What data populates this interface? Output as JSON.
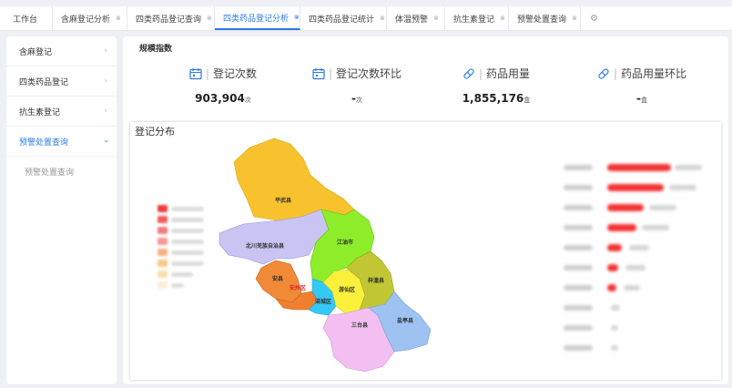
{
  "tabs": [
    {
      "label": "工作台",
      "closable": false,
      "active": false
    },
    {
      "label": "含麻登记分析",
      "closable": true,
      "active": false
    },
    {
      "label": "四类药品登记查询",
      "closable": true,
      "active": false
    },
    {
      "label": "四类药品登记分析",
      "closable": true,
      "active": true
    },
    {
      "label": "四类药品登记统计",
      "closable": true,
      "active": false
    },
    {
      "label": "体温预警",
      "closable": true,
      "active": false
    },
    {
      "label": "抗生素登记",
      "closable": true,
      "active": false
    },
    {
      "label": "预警处置查询",
      "closable": true,
      "active": false
    }
  ],
  "sidebar": {
    "items": [
      {
        "label": "含麻登记",
        "expanded": false
      },
      {
        "label": "四类药品登记",
        "expanded": false
      },
      {
        "label": "抗生素登记",
        "expanded": false
      },
      {
        "label": "预警处置查询",
        "expanded": true
      }
    ],
    "sub_items": [
      "预警处置查询"
    ]
  },
  "section_title": "规模指数",
  "metrics": [
    {
      "label": "登记次数",
      "value": "903,904",
      "unit": "次",
      "icon": "calendar-icon"
    },
    {
      "label": "登记次数环比",
      "value": "-",
      "unit": "次",
      "icon": "calendar-icon"
    },
    {
      "label": "药品用量",
      "value": "1,855,176",
      "unit": "盒",
      "icon": "pill-icon"
    },
    {
      "label": "药品用量环比",
      "value": "-",
      "unit": "盒",
      "icon": "pill-icon"
    }
  ],
  "distribution": {
    "title": "登记分布",
    "regions": [
      "平武县",
      "北川羌族自治县",
      "江油市",
      "安县",
      "安州区",
      "游仙区",
      "梓潼县",
      "涪城区",
      "三台县",
      "盐亭县"
    ]
  },
  "colors": {
    "accent": "#2d7be5",
    "bar": "#f23333"
  }
}
